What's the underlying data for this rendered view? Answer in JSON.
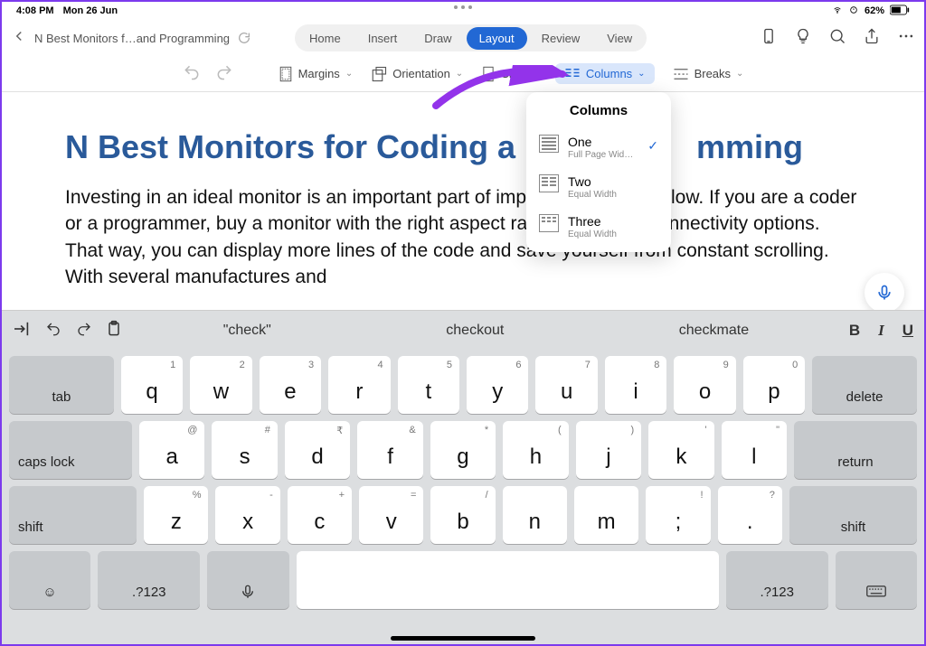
{
  "statusbar": {
    "time": "4:08 PM",
    "date": "Mon 26 Jun",
    "battery": "62%"
  },
  "titlebar": {
    "doc_title": "N Best Monitors f…and Programming",
    "tabs": [
      "Home",
      "Insert",
      "Draw",
      "Layout",
      "Review",
      "View"
    ],
    "active_tab_index": 3
  },
  "ribbon": {
    "items": [
      "Margins",
      "Orientation",
      "Size",
      "Columns",
      "Breaks"
    ],
    "active_index": 3
  },
  "popover": {
    "title": "Columns",
    "options": [
      {
        "label": "One",
        "sub": "Full Page Wid…",
        "selected": true
      },
      {
        "label": "Two",
        "sub": "Equal Width",
        "selected": false
      },
      {
        "label": "Three",
        "sub": "Equal Width",
        "selected": false
      }
    ]
  },
  "document": {
    "heading": "N Best Monitors for Coding and Programming",
    "heading_visible": "N Best Monitors for Coding a                    mming",
    "body": "Investing in an ideal monitor is an important part of improving your workflow. If you are a coder or a programmer, buy a monitor with the right aspect ratio with ample connectivity options. That way, you can display more lines of the code and save yourself from constant scrolling. With several manufactures and"
  },
  "keyboard": {
    "suggestions": [
      "\"check\"",
      "checkout",
      "checkmate"
    ],
    "row1": [
      {
        "main": "q",
        "alt": "1"
      },
      {
        "main": "w",
        "alt": "2"
      },
      {
        "main": "e",
        "alt": "3"
      },
      {
        "main": "r",
        "alt": "4"
      },
      {
        "main": "t",
        "alt": "5"
      },
      {
        "main": "y",
        "alt": "6"
      },
      {
        "main": "u",
        "alt": "7"
      },
      {
        "main": "i",
        "alt": "8"
      },
      {
        "main": "o",
        "alt": "9"
      },
      {
        "main": "p",
        "alt": "0"
      }
    ],
    "row2": [
      {
        "main": "a",
        "alt": "@"
      },
      {
        "main": "s",
        "alt": "#"
      },
      {
        "main": "d",
        "alt": "₹"
      },
      {
        "main": "f",
        "alt": "&"
      },
      {
        "main": "g",
        "alt": "*"
      },
      {
        "main": "h",
        "alt": "("
      },
      {
        "main": "j",
        "alt": ")"
      },
      {
        "main": "k",
        "alt": "'"
      },
      {
        "main": "l",
        "alt": "\""
      }
    ],
    "row3": [
      {
        "main": "z",
        "alt": "%"
      },
      {
        "main": "x",
        "alt": "-"
      },
      {
        "main": "c",
        "alt": "+"
      },
      {
        "main": "v",
        "alt": "="
      },
      {
        "main": "b",
        "alt": "/"
      },
      {
        "main": "n",
        "alt": ""
      },
      {
        "main": "m",
        "alt": ""
      },
      {
        "main": ";",
        "alt": "!"
      },
      {
        "main": ".",
        "alt": "?"
      }
    ],
    "func": {
      "tab": "tab",
      "delete": "delete",
      "caps": "caps lock",
      "return": "return",
      "shift_l": "shift",
      "shift_r": "shift",
      "numbers": ".?123"
    },
    "format": {
      "bold": "B",
      "italic": "I",
      "underline": "U"
    }
  }
}
